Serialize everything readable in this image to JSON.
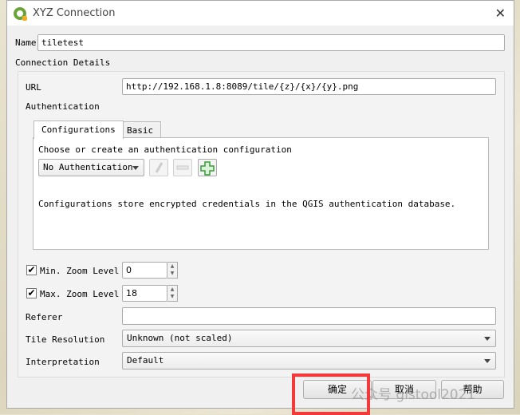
{
  "window": {
    "title": "XYZ Connection",
    "close_glyph": "✕"
  },
  "name": {
    "label": "Name",
    "value": "tiletest"
  },
  "connection_details": {
    "label": "Connection Details",
    "url": {
      "label": "URL",
      "value": "http://192.168.1.8:8089/tile/{z}/{x}/{y}.png"
    },
    "authentication": {
      "label": "Authentication",
      "tabs": [
        {
          "label": "Configurations",
          "active": true
        },
        {
          "label": "Basic",
          "active": false
        }
      ],
      "choose_text": "Choose or create an authentication configuration",
      "config_select": "No Authentication",
      "info_text": "Configurations store encrypted credentials in the QGIS authentication database."
    },
    "min_zoom": {
      "label": "Min. Zoom Level",
      "checked": true,
      "value": "0"
    },
    "max_zoom": {
      "label": "Max. Zoom Level",
      "checked": true,
      "value": "18"
    },
    "referer": {
      "label": "Referer",
      "value": ""
    },
    "tile_resolution": {
      "label": "Tile Resolution",
      "value": "Unknown (not scaled)"
    },
    "interpretation": {
      "label": "Interpretation",
      "value": "Default"
    }
  },
  "buttons": {
    "ok": "确定",
    "cancel": "取消",
    "help": "帮助"
  },
  "watermark": "公众号 gistool2021",
  "colors": {
    "highlight": "#f23a3a",
    "add_icon": "#3a9a3a"
  }
}
